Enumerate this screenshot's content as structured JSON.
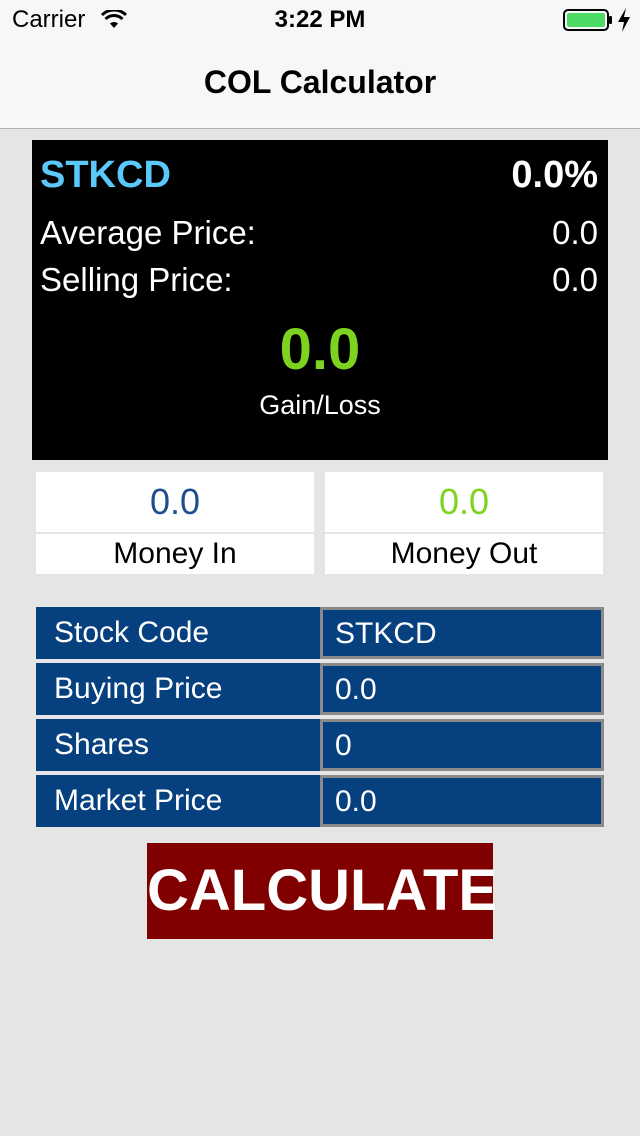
{
  "status_bar": {
    "carrier": "Carrier",
    "time": "3:22 PM",
    "battery_color": "#4cd964"
  },
  "nav": {
    "title": "COL Calculator"
  },
  "summary": {
    "stock_code": "STKCD",
    "percent": "0.0%",
    "average_price_label": "Average Price:",
    "average_price_value": "0.0",
    "selling_price_label": "Selling Price:",
    "selling_price_value": "0.0",
    "gain_value": "0.0",
    "gain_label": "Gain/Loss"
  },
  "money": {
    "in_value": "0.0",
    "in_label": "Money In",
    "out_value": "0.0",
    "out_label": "Money Out"
  },
  "form": {
    "rows": [
      {
        "label": "Stock Code",
        "value": "STKCD"
      },
      {
        "label": "Buying Price",
        "value": "0.0"
      },
      {
        "label": "Shares",
        "value": "0"
      },
      {
        "label": "Market Price",
        "value": "0.0"
      }
    ]
  },
  "calculate_label": "CALCULATE",
  "colors": {
    "accent_blue": "#5ac8fa",
    "gain_green": "#7ed321",
    "money_in_blue": "#1f4e8c",
    "form_blue": "#06407e",
    "button_red": "#800000"
  }
}
